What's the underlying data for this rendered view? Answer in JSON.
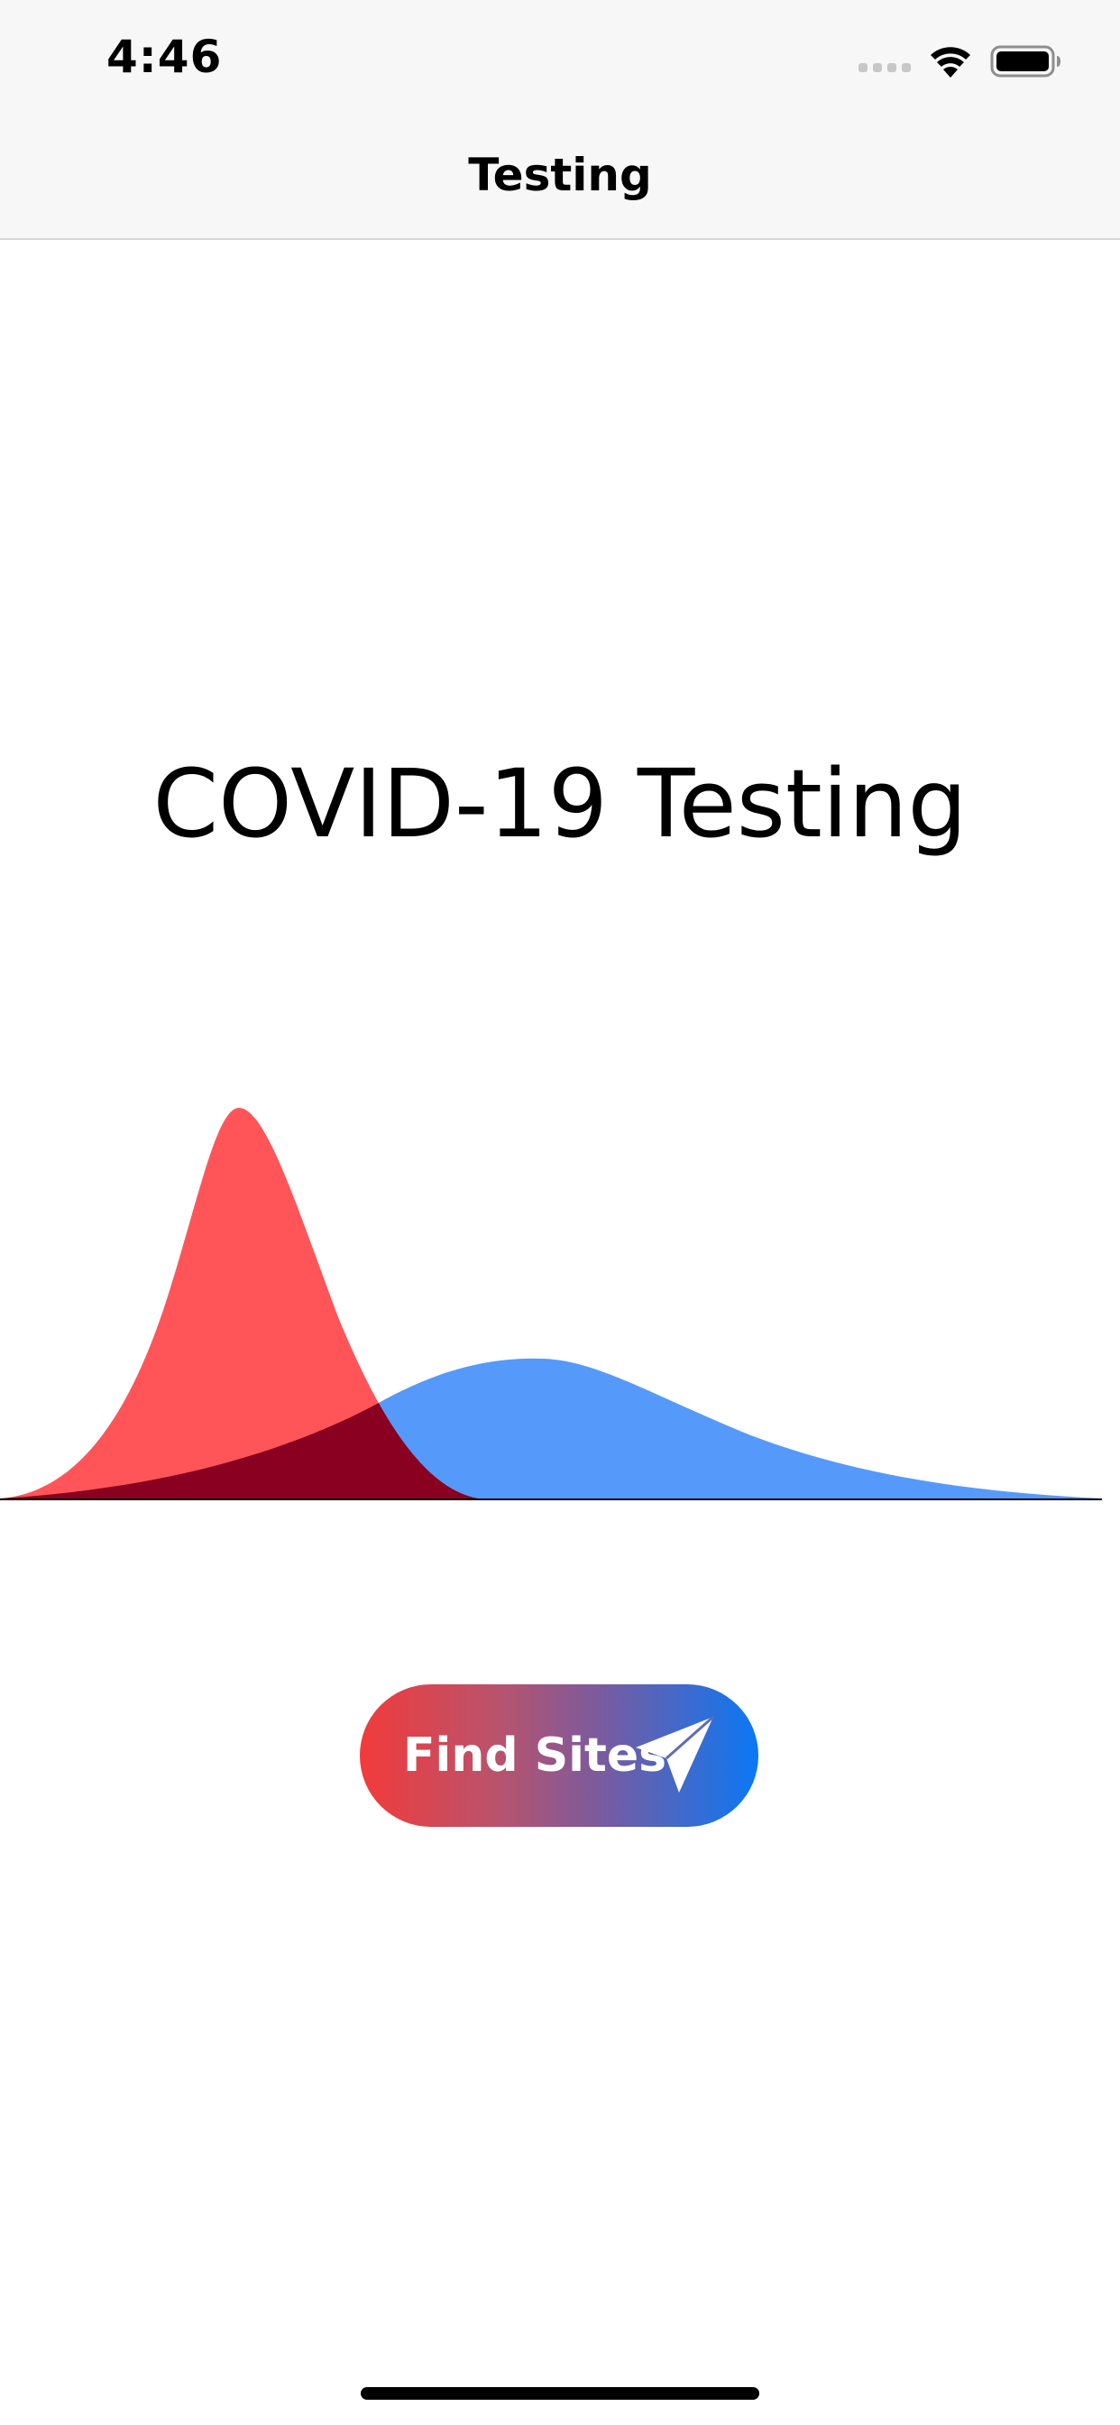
{
  "status_bar": {
    "time": "4:46",
    "icons": [
      "cellular-signal-icon",
      "wifi-icon",
      "battery-icon"
    ]
  },
  "nav": {
    "title": "Testing"
  },
  "main": {
    "headline": "COVID-19 Testing",
    "find_button_label": "Find Sites",
    "find_button_icon": "paper-plane-icon"
  },
  "colors": {
    "red_curve": "#ff5558",
    "blue_curve": "#5599fb",
    "overlap": "#8a0020",
    "button_gradient_start": "#f23b3b",
    "button_gradient_end": "#0a78f5"
  }
}
